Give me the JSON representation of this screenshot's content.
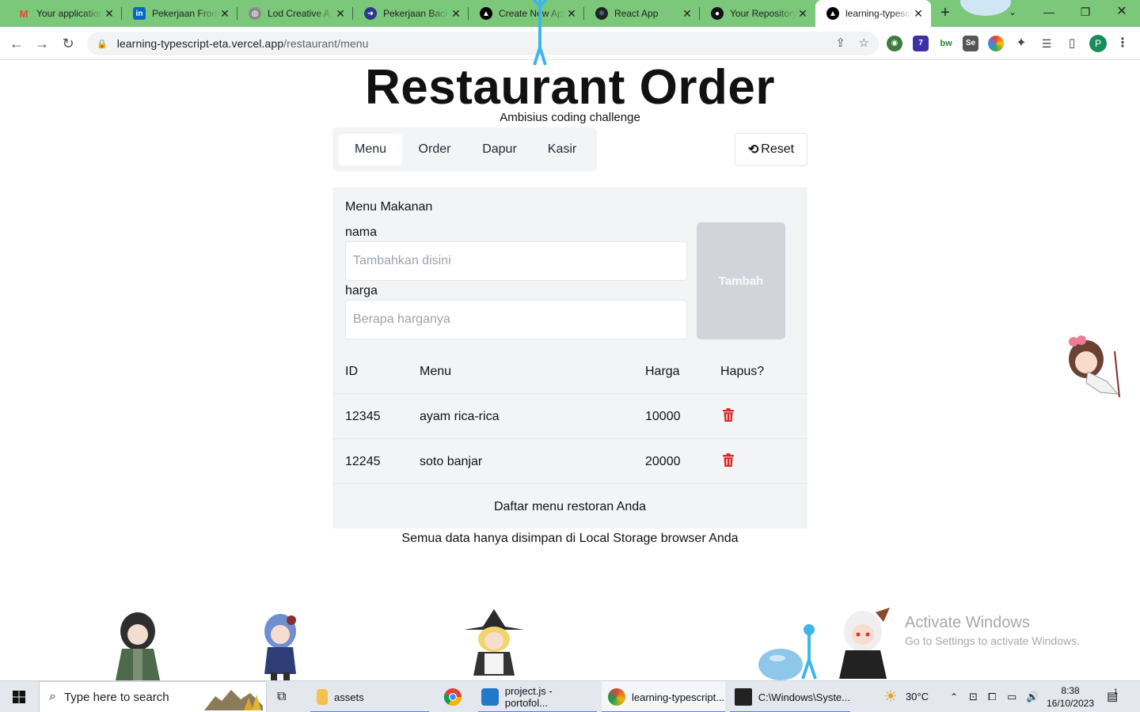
{
  "browser": {
    "tabs": [
      {
        "title": "Your application",
        "favicon": "gmail-icon",
        "color": "#ea4335"
      },
      {
        "title": "Pekerjaan Front",
        "favicon": "linkedin-icon",
        "color": "#0a66c2"
      },
      {
        "title": "Lod Creative A",
        "favicon": "globe-icon",
        "color": "#777777"
      },
      {
        "title": "Pekerjaan Back",
        "favicon": "site-icon",
        "color": "#2d3a8c"
      },
      {
        "title": "Create New App",
        "favicon": "vercel-icon",
        "color": "#000000"
      },
      {
        "title": "React App",
        "favicon": "react-icon",
        "color": "#222222"
      },
      {
        "title": "Your Repository",
        "favicon": "github-icon",
        "color": "#111111"
      },
      {
        "title": "learning-typescript",
        "favicon": "vercel-icon",
        "color": "#000000",
        "active": true
      }
    ],
    "url_host": "learning-typescript-eta.vercel.app",
    "url_path": "/restaurant/menu",
    "profile_initial": "P",
    "extension_badge": "7"
  },
  "app": {
    "title": "Restaurant Order",
    "subtitle": "Ambisius coding challenge",
    "nav": [
      {
        "label": "Menu",
        "active": true
      },
      {
        "label": "Order"
      },
      {
        "label": "Dapur"
      },
      {
        "label": "Kasir"
      }
    ],
    "reset_label": "Reset",
    "form": {
      "heading": "Menu Makanan",
      "name_label": "nama",
      "name_placeholder": "Tambahkan disini",
      "price_label": "harga",
      "price_placeholder": "Berapa harganya",
      "submit_label": "Tambah"
    },
    "table": {
      "headers": [
        "ID",
        "Menu",
        "Harga",
        "Hapus?"
      ],
      "rows": [
        {
          "id": "12345",
          "menu": "ayam rica-rica",
          "harga": "10000"
        },
        {
          "id": "12245",
          "menu": "soto banjar",
          "harga": "20000"
        }
      ],
      "footer": "Daftar menu restoran Anda"
    },
    "note": "Semua data hanya disimpan di Local Storage browser Anda",
    "accent_delete": "#dc2626"
  },
  "watermark": {
    "line1": "Activate Windows",
    "line2": "Go to Settings to activate Windows."
  },
  "taskbar": {
    "search_placeholder": "Type here to search",
    "apps": [
      {
        "label": "assets",
        "icon": "folder-icon"
      },
      {
        "label": "",
        "icon": "chrome-icon"
      },
      {
        "label": "project.js - portofol...",
        "icon": "vscode-icon"
      },
      {
        "label": "learning-typescript...",
        "icon": "chrome-profile-icon"
      },
      {
        "label": "C:\\Windows\\Syste...",
        "icon": "terminal-icon"
      }
    ],
    "weather": "30°C",
    "time": "8:38",
    "date": "16/10/2023",
    "notification_count": "1"
  }
}
